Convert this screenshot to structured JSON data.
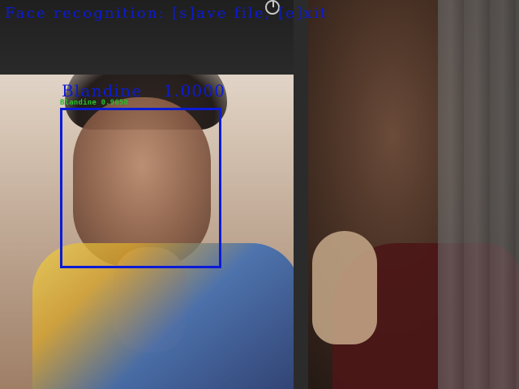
{
  "overlay": {
    "title": "Face recognition: [s]ave file, [e]xit",
    "detections": [
      {
        "name": "Blandine",
        "score_text": "1.0000",
        "secondary_text": "Blandine  0.9650"
      }
    ]
  },
  "colors": {
    "overlay_blue": "#0b1bd6",
    "overlay_green": "#29c12d"
  },
  "icons": [
    "camera-lens-icon"
  ]
}
